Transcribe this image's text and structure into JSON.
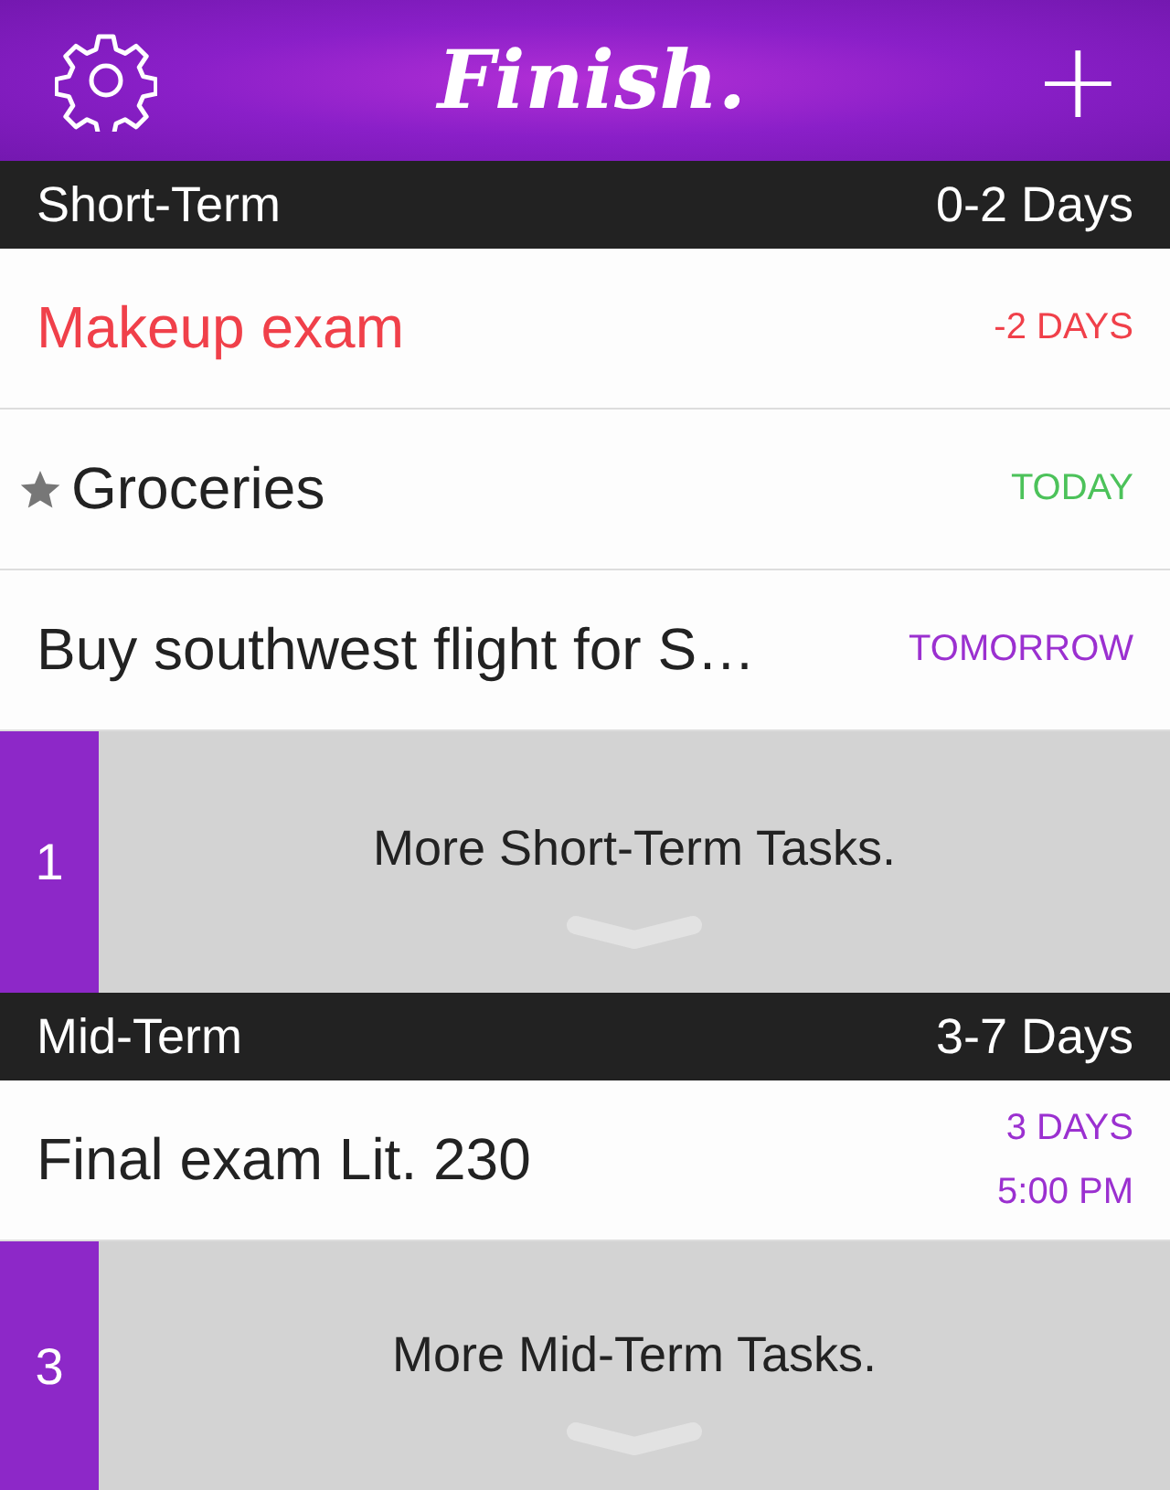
{
  "header": {
    "title": "Finish.",
    "add_label": "+"
  },
  "sections": [
    {
      "name": "Short-Term",
      "range": "0-2 Days",
      "tasks": [
        {
          "title": "Makeup exam",
          "overdue": true,
          "starred": false,
          "due": "-2 DAYS",
          "color": "#f0404a"
        },
        {
          "title": "Groceries",
          "overdue": false,
          "starred": true,
          "due": "TODAY",
          "color": "#4cc25a"
        },
        {
          "title": "Buy southwest flight for S…",
          "overdue": false,
          "starred": false,
          "due": "TOMORROW",
          "color": "#9b30d0"
        }
      ],
      "more": {
        "count": "1",
        "label": "More Short-Term Tasks."
      }
    },
    {
      "name": "Mid-Term",
      "range": "3-7 Days",
      "tasks": [
        {
          "title": "Final exam Lit. 230",
          "overdue": false,
          "starred": false,
          "due": "3 DAYS",
          "time": "5:00 PM",
          "color": "#9b30d0"
        }
      ],
      "more": {
        "count": "3",
        "label": "More Mid-Term Tasks."
      }
    }
  ]
}
